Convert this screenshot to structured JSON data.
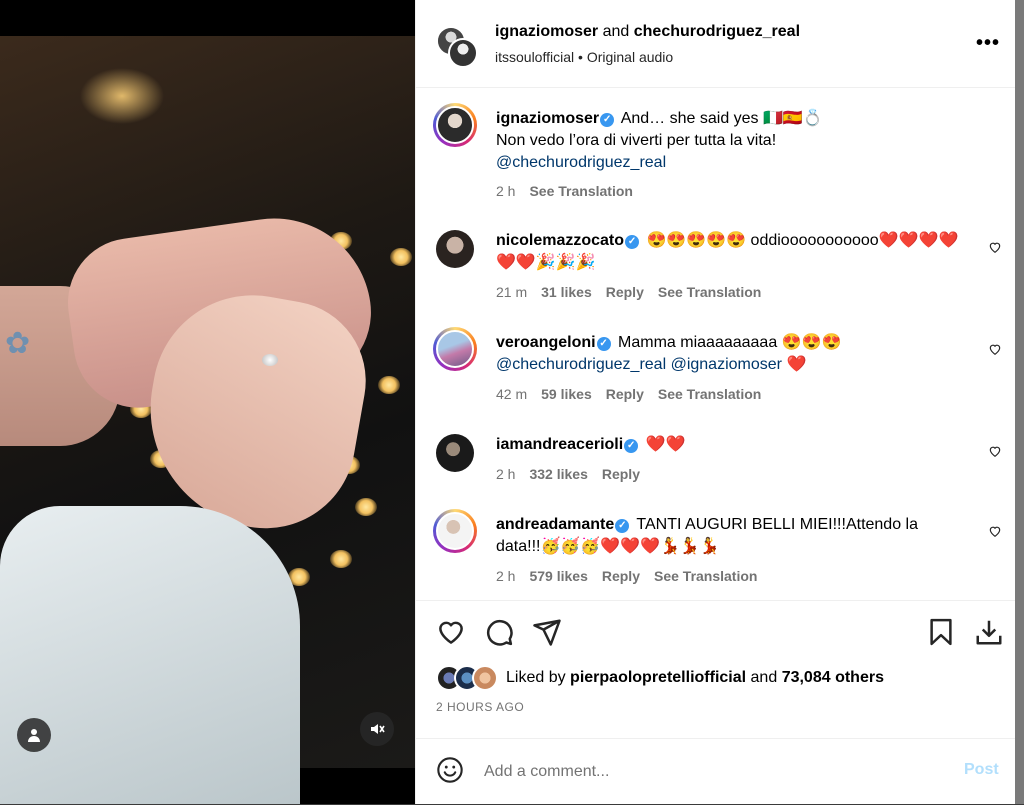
{
  "post": {
    "author": "ignaziomoser",
    "conjunction": "and",
    "collaborator": "chechurodriguez_real",
    "audio_artist": "itssoulofficial",
    "audio_separator": "•",
    "audio_label": "Original audio",
    "more_label": "•••"
  },
  "caption": {
    "username": "ignaziomoser",
    "line1": "And… she said yes 🇮🇹🇪🇸💍",
    "line2": "Non vedo l’ora di viverti per tutta la vita!",
    "mention": "@chechurodriguez_real",
    "time": "2 h",
    "see_translation": "See Translation"
  },
  "comments": [
    {
      "username": "nicolemazzocato",
      "text_line1": "😍😍😍😍😍 oddiooooooooooo❤️❤️❤️❤️",
      "text_line2": "❤️❤️🎉🎉🎉",
      "time": "21 m",
      "likes": "31 likes",
      "reply": "Reply",
      "see_translation": "See Translation"
    },
    {
      "username": "veroangeloni",
      "text_line1": "Mamma miaaaaaaaaa 😍😍😍",
      "mention1": "@chechurodriguez_real",
      "mention2": "@ignaziomoser",
      "text_tail": "❤️",
      "time": "42 m",
      "likes": "59 likes",
      "reply": "Reply",
      "see_translation": "See Translation"
    },
    {
      "username": "iamandreacerioli",
      "text_line1": "❤️❤️",
      "time": "2 h",
      "likes": "332 likes",
      "reply": "Reply"
    },
    {
      "username": "andreadamante",
      "text_line1": "TANTI AUGURI BELLI MIEI!!!Attendo la",
      "text_line2": "data!!!🥳🥳🥳❤️❤️❤️💃💃💃",
      "time": "2 h",
      "likes": "579 likes",
      "reply": "Reply",
      "see_translation": "See Translation"
    }
  ],
  "likes": {
    "prefix": "Liked by",
    "user": "pierpaolopretelliofficial",
    "middle": "and",
    "count": "73,084 others"
  },
  "timestamp": "2 HOURS AGO",
  "composer": {
    "placeholder": "Add a comment...",
    "post_label": "Post"
  },
  "colors": {
    "link": "#00376b",
    "meta": "#737373",
    "verified": "#3897f0",
    "post_disabled": "#b2dffc"
  }
}
